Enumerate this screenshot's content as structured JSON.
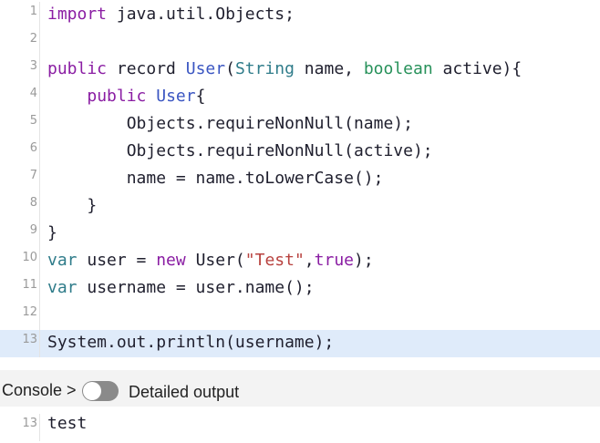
{
  "editor": {
    "lines": [
      {
        "no": "1",
        "tokens": [
          {
            "t": "import",
            "c": "kw"
          },
          {
            "t": " java.util.Objects;",
            "c": ""
          }
        ]
      },
      {
        "no": "2",
        "tokens": []
      },
      {
        "no": "3",
        "tokens": [
          {
            "t": "public",
            "c": "kw"
          },
          {
            "t": " record ",
            "c": ""
          },
          {
            "t": "User",
            "c": "cls"
          },
          {
            "t": "(",
            "c": ""
          },
          {
            "t": "String",
            "c": "type"
          },
          {
            "t": " name, ",
            "c": ""
          },
          {
            "t": "boolean",
            "c": "bool"
          },
          {
            "t": " active){",
            "c": ""
          }
        ]
      },
      {
        "no": "4",
        "tokens": [
          {
            "t": "    ",
            "c": ""
          },
          {
            "t": "public",
            "c": "kw"
          },
          {
            "t": " ",
            "c": ""
          },
          {
            "t": "User",
            "c": "cls"
          },
          {
            "t": "{",
            "c": ""
          }
        ]
      },
      {
        "no": "5",
        "tokens": [
          {
            "t": "        Objects.requireNonNull(name);",
            "c": ""
          }
        ]
      },
      {
        "no": "6",
        "tokens": [
          {
            "t": "        Objects.requireNonNull(active);",
            "c": ""
          }
        ]
      },
      {
        "no": "7",
        "tokens": [
          {
            "t": "        name = name.toLowerCase();",
            "c": ""
          }
        ]
      },
      {
        "no": "8",
        "tokens": [
          {
            "t": "    }",
            "c": ""
          }
        ]
      },
      {
        "no": "9",
        "tokens": [
          {
            "t": "}",
            "c": ""
          }
        ]
      },
      {
        "no": "10",
        "tokens": [
          {
            "t": "var",
            "c": "type"
          },
          {
            "t": " user = ",
            "c": ""
          },
          {
            "t": "new",
            "c": "kw"
          },
          {
            "t": " User(",
            "c": ""
          },
          {
            "t": "\"Test\"",
            "c": "str"
          },
          {
            "t": ",",
            "c": ""
          },
          {
            "t": "true",
            "c": "lit"
          },
          {
            "t": ");",
            "c": ""
          }
        ]
      },
      {
        "no": "11",
        "tokens": [
          {
            "t": "var",
            "c": "type"
          },
          {
            "t": " username = user.name();",
            "c": ""
          }
        ]
      },
      {
        "no": "12",
        "tokens": []
      },
      {
        "no": "13",
        "tokens": [
          {
            "t": "System.out.println(username);",
            "c": ""
          }
        ],
        "active": true
      }
    ]
  },
  "console": {
    "label": "Console >",
    "toggle_label": "Detailed output",
    "toggle_on": false
  },
  "output": {
    "line_no": "13",
    "text": "test"
  },
  "colors": {
    "keyword": "#8a1da3",
    "type": "#2f7c8a",
    "class": "#3b56c2",
    "boolean_type": "#27915a",
    "string": "#b8423f",
    "active_line": "#dfebfa",
    "console_bg": "#f3f3f3"
  }
}
